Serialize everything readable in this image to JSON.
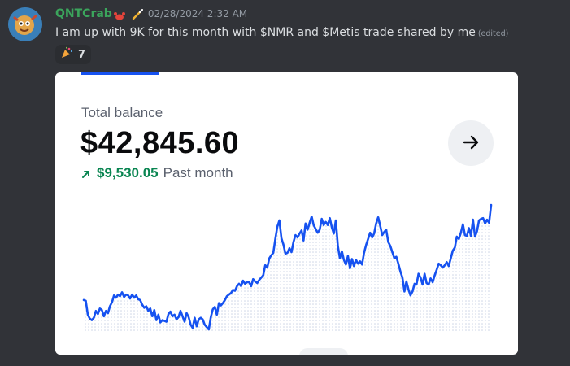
{
  "message": {
    "username": "QNTCrab",
    "timestamp": "02/28/2024 2:32 AM",
    "text": "I am up with 9K for this month with $NMR and $Metis trade shared by me",
    "edited_label": "(edited)",
    "reaction": {
      "emoji_icon": "party-popper-icon",
      "count": "7"
    }
  },
  "card": {
    "balance_label": "Total balance",
    "balance_value": "$42,845.60",
    "change_value": "$9,530.05",
    "change_period": "Past month",
    "arrow_icon": "arrow-right-icon"
  },
  "colors": {
    "background": "#313338",
    "username": "#3ba55c",
    "line": "#1652f0",
    "positive": "#098551"
  },
  "chart_data": {
    "type": "line",
    "title": "",
    "xlabel": "",
    "ylabel": "",
    "series": [
      {
        "values": [
          36.2,
          36.1,
          34.3,
          33.8,
          33.6,
          33.9,
          34.8,
          34.4,
          35.1,
          34.9,
          34.1,
          34.8,
          34.5,
          35.4,
          35.9,
          36.8,
          36.5,
          36.9,
          36.7,
          37.2,
          36.6,
          36.9,
          36.8,
          36.4,
          36.9,
          36.5,
          36.8,
          36.3,
          36.2,
          35.6,
          35.2,
          35.4,
          34.8,
          35.1,
          34.1,
          34.9,
          33.6,
          34.3,
          33.3,
          33.6,
          33.5,
          33.4,
          34.4,
          34.7,
          34.1,
          34.3,
          33.7,
          34.0,
          34.8,
          34.1,
          33.4,
          34.5,
          34.0,
          33.0,
          32.6,
          33.9,
          32.8,
          33.7,
          33.9,
          33.7,
          33.0,
          32.7,
          32.4,
          34.0,
          35.0,
          35.3,
          34.3,
          35.8,
          35.5,
          35.8,
          36.2,
          36.7,
          36.9,
          37.1,
          37.5,
          37.4,
          38.0,
          38.3,
          38.0,
          38.7,
          38.3,
          38.5,
          38.5,
          38.0,
          38.9,
          38.6,
          38.4,
          38.8,
          39.1,
          39.4,
          40.7,
          40.4,
          41.6,
          42.0,
          42.3,
          44.1,
          45.7,
          46.5,
          44.2,
          43.4,
          42.2,
          42.3,
          42.9,
          42.4,
          43.7,
          44.6,
          44.3,
          44.8,
          45.2,
          43.9,
          46.1,
          45.3,
          46.2,
          47.0,
          45.9,
          45.4,
          44.9,
          45.3,
          46.7,
          45.9,
          46.3,
          45.9,
          46.8,
          45.6,
          44.8,
          46.5,
          43.2,
          41.6,
          42.5,
          41.4,
          40.8,
          41.9,
          40.3,
          41.5,
          40.6,
          41.4,
          40.9,
          41.2,
          40.8,
          42.3,
          43.3,
          44.1,
          44.9,
          44.3,
          44.8,
          46.1,
          46.9,
          45.8,
          44.6,
          45.0,
          45.3,
          43.7,
          43.2,
          42.4,
          41.6,
          41.8,
          40.9,
          39.9,
          39.1,
          37.3,
          38.6,
          37.6,
          36.8,
          37.3,
          38.3,
          38.2,
          39.6,
          39.1,
          38.2,
          39.6,
          38.4,
          38.2,
          39.0,
          38.5,
          39.4,
          40.1,
          40.9,
          40.7,
          40.4,
          40.7,
          41.1,
          40.6,
          41.6,
          42.6,
          43.0,
          44.4,
          44.1,
          44.9,
          46.0,
          44.6,
          44.5,
          45.5,
          44.5,
          46.6,
          44.4,
          45.1,
          46.5,
          46.7,
          46.8,
          46.1,
          46.6,
          46.2,
          48.5
        ]
      }
    ],
    "grid": false,
    "legend": "none"
  }
}
